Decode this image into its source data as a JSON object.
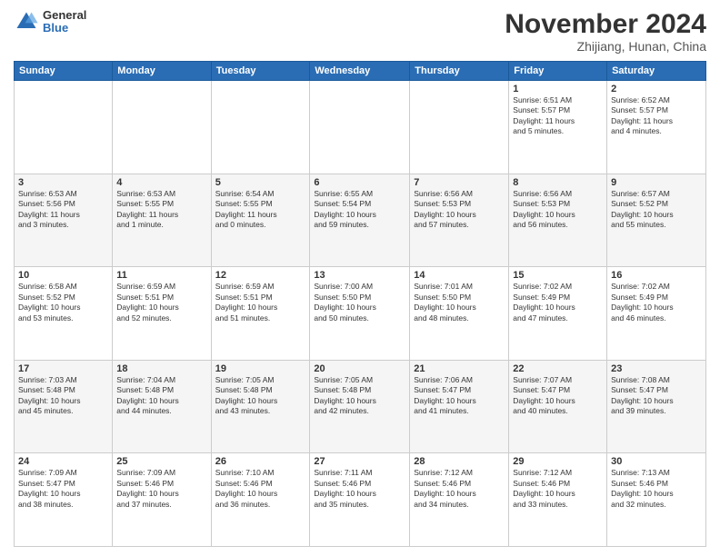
{
  "logo": {
    "general": "General",
    "blue": "Blue"
  },
  "title": "November 2024",
  "location": "Zhijiang, Hunan, China",
  "days_of_week": [
    "Sunday",
    "Monday",
    "Tuesday",
    "Wednesday",
    "Thursday",
    "Friday",
    "Saturday"
  ],
  "weeks": [
    [
      {
        "day": "",
        "info": ""
      },
      {
        "day": "",
        "info": ""
      },
      {
        "day": "",
        "info": ""
      },
      {
        "day": "",
        "info": ""
      },
      {
        "day": "",
        "info": ""
      },
      {
        "day": "1",
        "info": "Sunrise: 6:51 AM\nSunset: 5:57 PM\nDaylight: 11 hours\nand 5 minutes."
      },
      {
        "day": "2",
        "info": "Sunrise: 6:52 AM\nSunset: 5:57 PM\nDaylight: 11 hours\nand 4 minutes."
      }
    ],
    [
      {
        "day": "3",
        "info": "Sunrise: 6:53 AM\nSunset: 5:56 PM\nDaylight: 11 hours\nand 3 minutes."
      },
      {
        "day": "4",
        "info": "Sunrise: 6:53 AM\nSunset: 5:55 PM\nDaylight: 11 hours\nand 1 minute."
      },
      {
        "day": "5",
        "info": "Sunrise: 6:54 AM\nSunset: 5:55 PM\nDaylight: 11 hours\nand 0 minutes."
      },
      {
        "day": "6",
        "info": "Sunrise: 6:55 AM\nSunset: 5:54 PM\nDaylight: 10 hours\nand 59 minutes."
      },
      {
        "day": "7",
        "info": "Sunrise: 6:56 AM\nSunset: 5:53 PM\nDaylight: 10 hours\nand 57 minutes."
      },
      {
        "day": "8",
        "info": "Sunrise: 6:56 AM\nSunset: 5:53 PM\nDaylight: 10 hours\nand 56 minutes."
      },
      {
        "day": "9",
        "info": "Sunrise: 6:57 AM\nSunset: 5:52 PM\nDaylight: 10 hours\nand 55 minutes."
      }
    ],
    [
      {
        "day": "10",
        "info": "Sunrise: 6:58 AM\nSunset: 5:52 PM\nDaylight: 10 hours\nand 53 minutes."
      },
      {
        "day": "11",
        "info": "Sunrise: 6:59 AM\nSunset: 5:51 PM\nDaylight: 10 hours\nand 52 minutes."
      },
      {
        "day": "12",
        "info": "Sunrise: 6:59 AM\nSunset: 5:51 PM\nDaylight: 10 hours\nand 51 minutes."
      },
      {
        "day": "13",
        "info": "Sunrise: 7:00 AM\nSunset: 5:50 PM\nDaylight: 10 hours\nand 50 minutes."
      },
      {
        "day": "14",
        "info": "Sunrise: 7:01 AM\nSunset: 5:50 PM\nDaylight: 10 hours\nand 48 minutes."
      },
      {
        "day": "15",
        "info": "Sunrise: 7:02 AM\nSunset: 5:49 PM\nDaylight: 10 hours\nand 47 minutes."
      },
      {
        "day": "16",
        "info": "Sunrise: 7:02 AM\nSunset: 5:49 PM\nDaylight: 10 hours\nand 46 minutes."
      }
    ],
    [
      {
        "day": "17",
        "info": "Sunrise: 7:03 AM\nSunset: 5:48 PM\nDaylight: 10 hours\nand 45 minutes."
      },
      {
        "day": "18",
        "info": "Sunrise: 7:04 AM\nSunset: 5:48 PM\nDaylight: 10 hours\nand 44 minutes."
      },
      {
        "day": "19",
        "info": "Sunrise: 7:05 AM\nSunset: 5:48 PM\nDaylight: 10 hours\nand 43 minutes."
      },
      {
        "day": "20",
        "info": "Sunrise: 7:05 AM\nSunset: 5:48 PM\nDaylight: 10 hours\nand 42 minutes."
      },
      {
        "day": "21",
        "info": "Sunrise: 7:06 AM\nSunset: 5:47 PM\nDaylight: 10 hours\nand 41 minutes."
      },
      {
        "day": "22",
        "info": "Sunrise: 7:07 AM\nSunset: 5:47 PM\nDaylight: 10 hours\nand 40 minutes."
      },
      {
        "day": "23",
        "info": "Sunrise: 7:08 AM\nSunset: 5:47 PM\nDaylight: 10 hours\nand 39 minutes."
      }
    ],
    [
      {
        "day": "24",
        "info": "Sunrise: 7:09 AM\nSunset: 5:47 PM\nDaylight: 10 hours\nand 38 minutes."
      },
      {
        "day": "25",
        "info": "Sunrise: 7:09 AM\nSunset: 5:46 PM\nDaylight: 10 hours\nand 37 minutes."
      },
      {
        "day": "26",
        "info": "Sunrise: 7:10 AM\nSunset: 5:46 PM\nDaylight: 10 hours\nand 36 minutes."
      },
      {
        "day": "27",
        "info": "Sunrise: 7:11 AM\nSunset: 5:46 PM\nDaylight: 10 hours\nand 35 minutes."
      },
      {
        "day": "28",
        "info": "Sunrise: 7:12 AM\nSunset: 5:46 PM\nDaylight: 10 hours\nand 34 minutes."
      },
      {
        "day": "29",
        "info": "Sunrise: 7:12 AM\nSunset: 5:46 PM\nDaylight: 10 hours\nand 33 minutes."
      },
      {
        "day": "30",
        "info": "Sunrise: 7:13 AM\nSunset: 5:46 PM\nDaylight: 10 hours\nand 32 minutes."
      }
    ]
  ]
}
